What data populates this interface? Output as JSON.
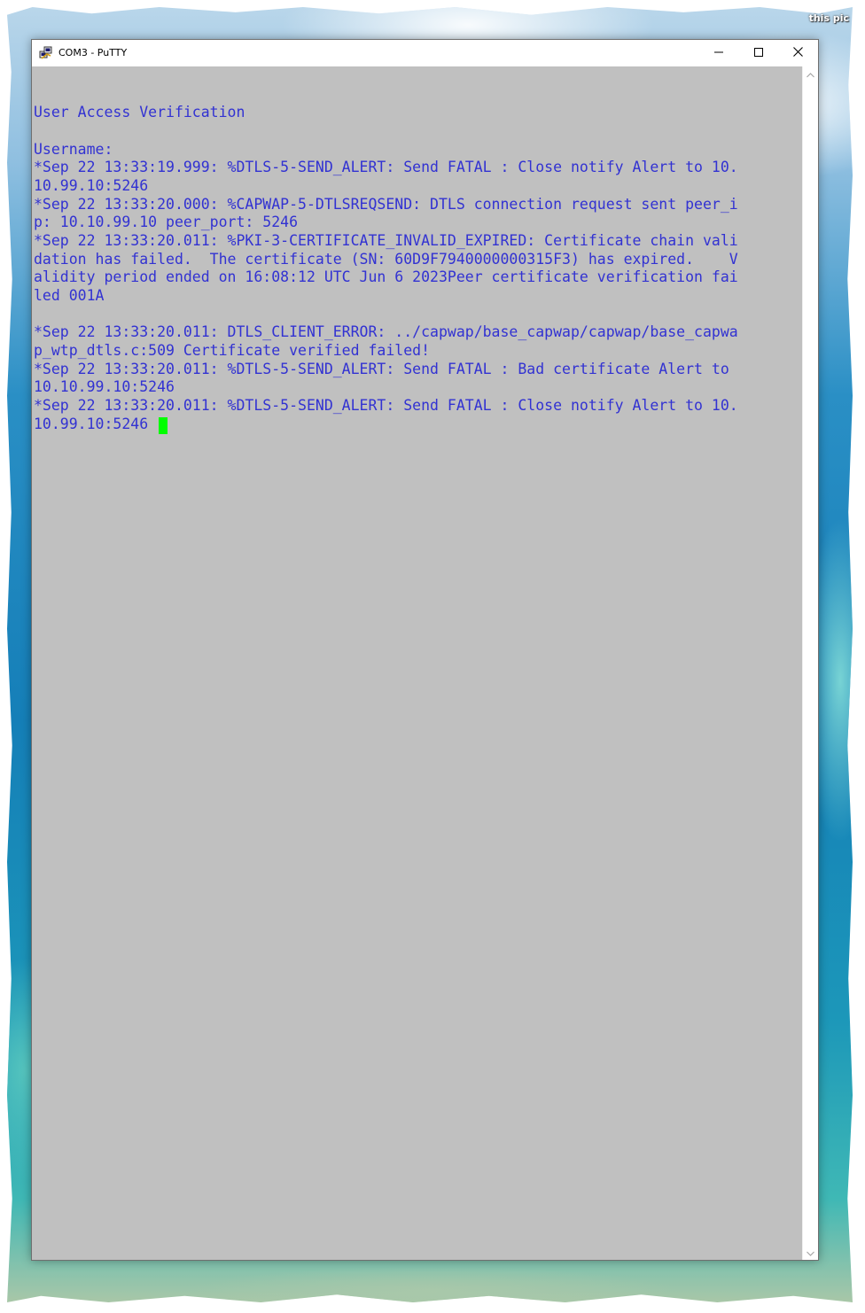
{
  "watermark": "this pic",
  "window": {
    "title": "COM3 - PuTTY",
    "icons": {
      "app": "putty-icon",
      "minimize": "minimize-icon",
      "maximize": "maximize-icon",
      "close": "close-icon",
      "scroll_up": "chevron-up-icon",
      "scroll_down": "chevron-down-icon"
    }
  },
  "terminal": {
    "background": "#c0c0c0",
    "text_color": "#3232d2",
    "cursor_color": "#00ff00",
    "lines": [
      "User Access Verification",
      "",
      "Username:",
      "*Sep 22 13:33:19.999: %DTLS-5-SEND_ALERT: Send FATAL : Close notify Alert to 10.",
      "10.99.10:5246",
      "*Sep 22 13:33:20.000: %CAPWAP-5-DTLSREQSEND: DTLS connection request sent peer_i",
      "p: 10.10.99.10 peer_port: 5246",
      "*Sep 22 13:33:20.011: %PKI-3-CERTIFICATE_INVALID_EXPIRED: Certificate chain vali",
      "dation has failed.  The certificate (SN: 60D9F7940000000315F3) has expired.    V",
      "alidity period ended on 16:08:12 UTC Jun 6 2023Peer certificate verification fai",
      "led 001A",
      "",
      "*Sep 22 13:33:20.011: DTLS_CLIENT_ERROR: ../capwap/base_capwap/capwap/base_capwa",
      "p_wtp_dtls.c:509 Certificate verified failed!",
      "*Sep 22 13:33:20.011: %DTLS-5-SEND_ALERT: Send FATAL : Bad certificate Alert to",
      "10.10.99.10:5246",
      "*Sep 22 13:33:20.011: %DTLS-5-SEND_ALERT: Send FATAL : Close notify Alert to 10.",
      "10.99.10:5246"
    ]
  }
}
